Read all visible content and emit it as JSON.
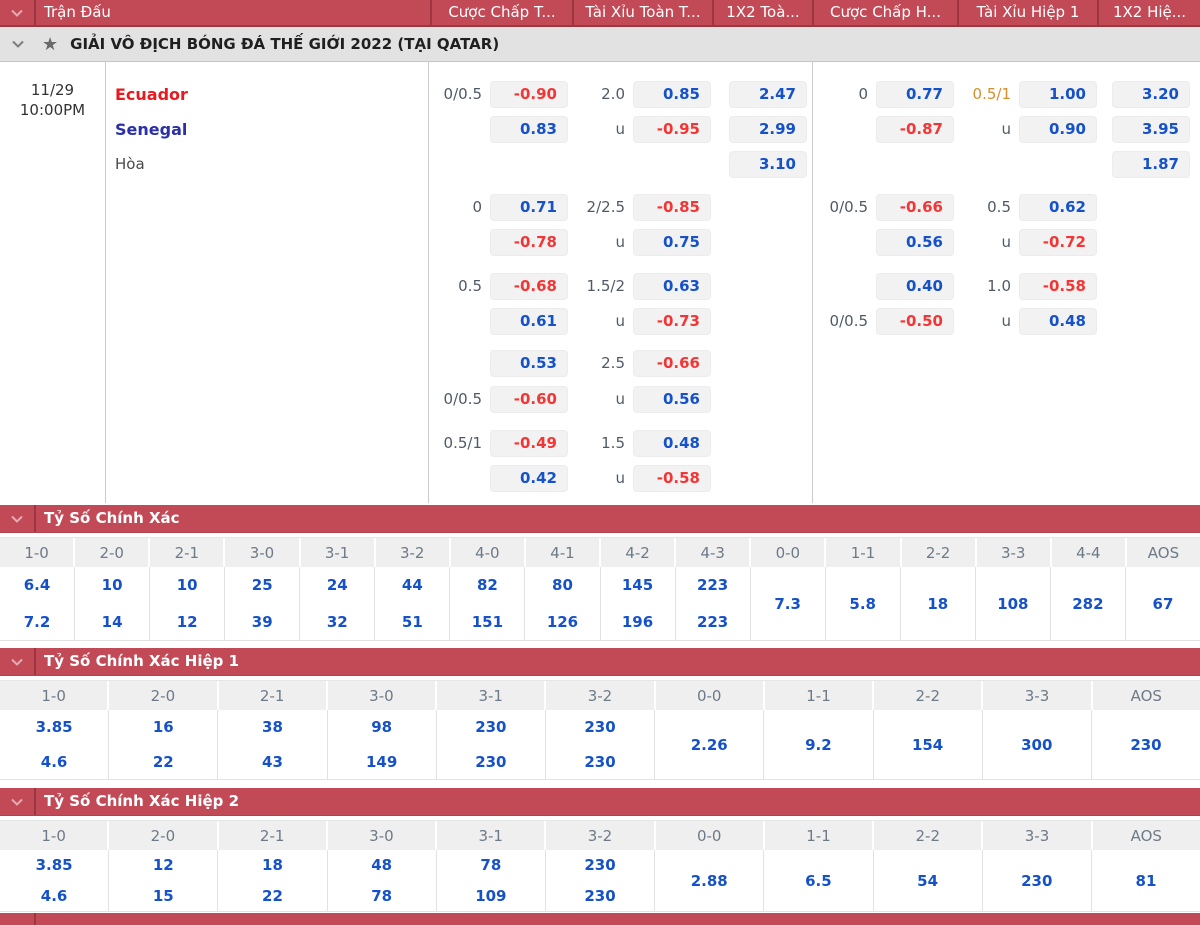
{
  "top_header": {
    "columns": [
      {
        "id": "match",
        "label": "Trận Đấu"
      },
      {
        "id": "ft-handicap",
        "label": "Cược Chấp T..."
      },
      {
        "id": "ft-over-under",
        "label": "Tài Xỉu Toàn T..."
      },
      {
        "id": "ft-1x2",
        "label": "1X2 Toà..."
      },
      {
        "id": "h1-handicap",
        "label": "Cược Chấp H..."
      },
      {
        "id": "h1-over-under",
        "label": "Tài Xỉu Hiệp 1"
      },
      {
        "id": "h1-1x2",
        "label": "1X2 Hiệ..."
      }
    ]
  },
  "league": {
    "title": "GIẢI VÔ ĐỊCH BÓNG ĐÁ THẾ GIỚI 2022 (TẠI QATAR)"
  },
  "match": {
    "date": "11/29",
    "time": "10:00PM",
    "home": "Ecuador",
    "away": "Senegal",
    "draw": "Hòa"
  },
  "odds_groups": [
    {
      "ft_hcp": [
        {
          "line": "0/0.5",
          "odds": "-0.90",
          "c": "red"
        },
        {
          "line": "",
          "odds": "0.83",
          "c": "blue"
        }
      ],
      "ft_ou": [
        {
          "line": "2.0",
          "odds": "0.85",
          "c": "blue"
        },
        {
          "line": "u",
          "odds": "-0.95",
          "c": "red"
        }
      ],
      "ft_1x2": [
        {
          "odds": "2.47",
          "c": "blue"
        },
        {
          "odds": "2.99",
          "c": "blue"
        },
        {
          "odds": "3.10",
          "c": "blue"
        }
      ],
      "h1_hcp": [
        {
          "line": "0",
          "odds": "0.77",
          "c": "blue"
        },
        {
          "line": "",
          "odds": "-0.87",
          "c": "red"
        }
      ],
      "h1_ou": [
        {
          "line": "0.5/1",
          "lc": "orange",
          "odds": "1.00",
          "c": "blue"
        },
        {
          "line": "u",
          "odds": "0.90",
          "c": "blue"
        }
      ],
      "h1_1x2": [
        {
          "odds": "3.20",
          "c": "blue"
        },
        {
          "odds": "3.95",
          "c": "blue"
        },
        {
          "odds": "1.87",
          "c": "blue"
        }
      ]
    },
    {
      "ft_hcp": [
        {
          "line": "0",
          "odds": "0.71",
          "c": "blue"
        },
        {
          "line": "",
          "odds": "-0.78",
          "c": "red"
        }
      ],
      "ft_ou": [
        {
          "line": "2/2.5",
          "odds": "-0.85",
          "c": "red"
        },
        {
          "line": "u",
          "odds": "0.75",
          "c": "blue"
        }
      ],
      "h1_hcp": [
        {
          "line": "0/0.5",
          "odds": "-0.66",
          "c": "red"
        },
        {
          "line": "",
          "odds": "0.56",
          "c": "blue"
        }
      ],
      "h1_ou": [
        {
          "line": "0.5",
          "odds": "0.62",
          "c": "blue"
        },
        {
          "line": "u",
          "odds": "-0.72",
          "c": "red"
        }
      ]
    },
    {
      "ft_hcp": [
        {
          "line": "0.5",
          "odds": "-0.68",
          "c": "red"
        },
        {
          "line": "",
          "odds": "0.61",
          "c": "blue"
        }
      ],
      "ft_ou": [
        {
          "line": "1.5/2",
          "odds": "0.63",
          "c": "blue"
        },
        {
          "line": "u",
          "odds": "-0.73",
          "c": "red"
        }
      ],
      "h1_hcp": [
        {
          "line": "",
          "odds": "0.40",
          "c": "blue"
        },
        {
          "line": "0/0.5",
          "odds": "-0.50",
          "c": "red"
        }
      ],
      "h1_ou": [
        {
          "line": "1.0",
          "odds": "-0.58",
          "c": "red"
        },
        {
          "line": "u",
          "odds": "0.48",
          "c": "blue"
        }
      ]
    },
    {
      "ft_hcp": [
        {
          "line": "",
          "odds": "0.53",
          "c": "blue"
        },
        {
          "line": "0/0.5",
          "odds": "-0.60",
          "c": "red"
        }
      ],
      "ft_ou": [
        {
          "line": "2.5",
          "odds": "-0.66",
          "c": "red"
        },
        {
          "line": "u",
          "odds": "0.56",
          "c": "blue"
        }
      ]
    },
    {
      "ft_hcp": [
        {
          "line": "0.5/1",
          "odds": "-0.49",
          "c": "red"
        },
        {
          "line": "",
          "odds": "0.42",
          "c": "blue"
        }
      ],
      "ft_ou": [
        {
          "line": "1.5",
          "odds": "0.48",
          "c": "blue"
        },
        {
          "line": "u",
          "odds": "-0.58",
          "c": "red"
        }
      ]
    }
  ],
  "score_sections": [
    {
      "title": "Tỷ Số Chính Xác",
      "columns": [
        {
          "score": "1-0",
          "values": [
            "6.4",
            "7.2"
          ]
        },
        {
          "score": "2-0",
          "values": [
            "10",
            "14"
          ]
        },
        {
          "score": "2-1",
          "values": [
            "10",
            "12"
          ]
        },
        {
          "score": "3-0",
          "values": [
            "25",
            "39"
          ]
        },
        {
          "score": "3-1",
          "values": [
            "24",
            "32"
          ]
        },
        {
          "score": "3-2",
          "values": [
            "44",
            "51"
          ]
        },
        {
          "score": "4-0",
          "values": [
            "82",
            "151"
          ]
        },
        {
          "score": "4-1",
          "values": [
            "80",
            "126"
          ]
        },
        {
          "score": "4-2",
          "values": [
            "145",
            "196"
          ]
        },
        {
          "score": "4-3",
          "values": [
            "223",
            "223"
          ]
        },
        {
          "score": "0-0",
          "values": [
            "7.3"
          ]
        },
        {
          "score": "1-1",
          "values": [
            "5.8"
          ]
        },
        {
          "score": "2-2",
          "values": [
            "18"
          ]
        },
        {
          "score": "3-3",
          "values": [
            "108"
          ]
        },
        {
          "score": "4-4",
          "values": [
            "282"
          ]
        },
        {
          "score": "AOS",
          "values": [
            "67"
          ]
        }
      ]
    },
    {
      "title": "Tỷ Số Chính Xác Hiệp 1",
      "columns": [
        {
          "score": "1-0",
          "values": [
            "3.85",
            "4.6"
          ]
        },
        {
          "score": "2-0",
          "values": [
            "16",
            "22"
          ]
        },
        {
          "score": "2-1",
          "values": [
            "38",
            "43"
          ]
        },
        {
          "score": "3-0",
          "values": [
            "98",
            "149"
          ]
        },
        {
          "score": "3-1",
          "values": [
            "230",
            "230"
          ]
        },
        {
          "score": "3-2",
          "values": [
            "230",
            "230"
          ]
        },
        {
          "score": "0-0",
          "values": [
            "2.26"
          ]
        },
        {
          "score": "1-1",
          "values": [
            "9.2"
          ]
        },
        {
          "score": "2-2",
          "values": [
            "154"
          ]
        },
        {
          "score": "3-3",
          "values": [
            "300"
          ]
        },
        {
          "score": "AOS",
          "values": [
            "230"
          ]
        }
      ]
    },
    {
      "title": "Tỷ Số Chính Xác Hiệp 2",
      "columns": [
        {
          "score": "1-0",
          "values": [
            "3.85",
            "4.6"
          ]
        },
        {
          "score": "2-0",
          "values": [
            "12",
            "15"
          ]
        },
        {
          "score": "2-1",
          "values": [
            "18",
            "22"
          ]
        },
        {
          "score": "3-0",
          "values": [
            "48",
            "78"
          ]
        },
        {
          "score": "3-1",
          "values": [
            "78",
            "109"
          ]
        },
        {
          "score": "3-2",
          "values": [
            "230",
            "230"
          ]
        },
        {
          "score": "0-0",
          "values": [
            "2.88"
          ]
        },
        {
          "score": "1-1",
          "values": [
            "6.5"
          ]
        },
        {
          "score": "2-2",
          "values": [
            "54"
          ]
        },
        {
          "score": "3-3",
          "values": [
            "230"
          ]
        },
        {
          "score": "AOS",
          "values": [
            "81"
          ]
        }
      ]
    }
  ],
  "colors": {
    "header_red": "#c24a56",
    "header_separator": "#9c3641",
    "odds_blue": "#1551c9",
    "odds_red": "#f43535",
    "line_orange": "#d78f2c",
    "home_red": "#e8191f",
    "away_blue": "#2b2fa8"
  }
}
